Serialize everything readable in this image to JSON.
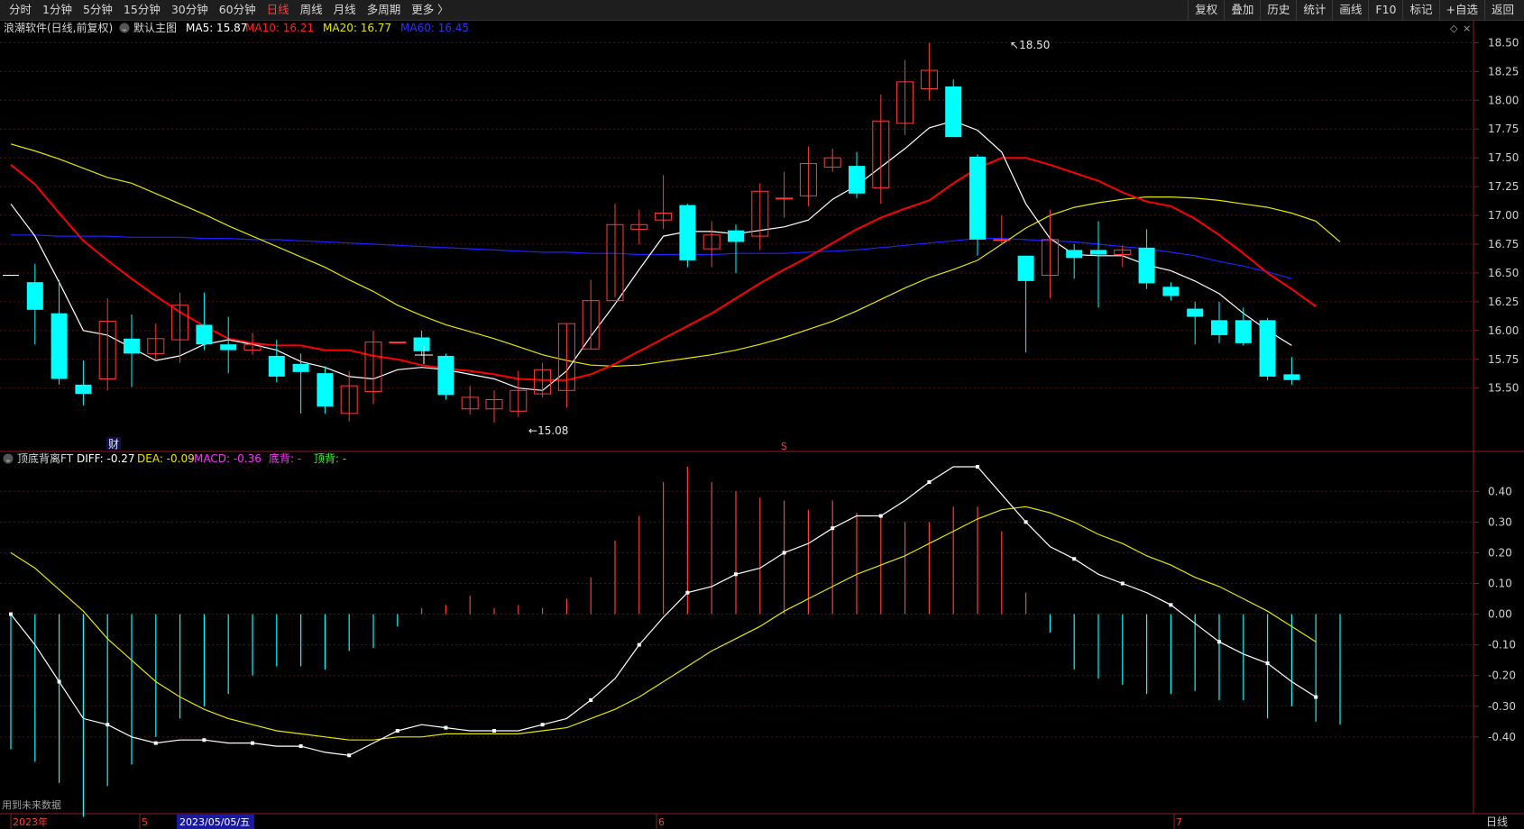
{
  "toolbar": {
    "left": [
      "分时",
      "1分钟",
      "5分钟",
      "15分钟",
      "30分钟",
      "60分钟",
      "日线",
      "周线",
      "月线",
      "多周期",
      "更多 〉"
    ],
    "active": "日线",
    "right": [
      "复权",
      "叠加",
      "历史",
      "统计",
      "画线",
      "F10",
      "标记",
      "+自选",
      "返回"
    ]
  },
  "main_panel": {
    "title": "浪潮软件(日线,前复权)",
    "style_label": "默认主图",
    "ma5": "MA5: 15.87",
    "ma10": "MA10: 16.21",
    "ma20": "MA20: 16.77",
    "ma60": "MA60: 16.45",
    "high_label": "18.50",
    "low_label": "15.08",
    "cai_marker": "财",
    "s_marker": "S"
  },
  "macd_panel": {
    "title": "顶底背离FT",
    "diff": "DIFF: -0.27",
    "dea": "DEA: -0.09",
    "macd": "MACD: -0.36",
    "bottom_div": "底背: -",
    "top_div": "顶背: -",
    "future_note": "用到未来数据"
  },
  "date_axis": {
    "labels": [
      "2023年",
      "5",
      "2023/05/05/五",
      "6",
      "7"
    ],
    "period_label": "日线"
  },
  "colors": {
    "up": "#ff3b3b",
    "down": "#00ffff",
    "ma5": "#ffffff",
    "ma10": "#ff0000",
    "ma20": "#e6e600",
    "ma60": "#2020ff",
    "macd_pos": "#ff3b3b",
    "macd_neg": "#00ffff"
  },
  "chart_data": [
    {
      "type": "candlestick",
      "price_axis": {
        "ticks": [
          18.5,
          18.25,
          18.0,
          17.75,
          17.5,
          17.25,
          17.0,
          16.75,
          16.5,
          16.25,
          16.0,
          15.75,
          15.5
        ],
        "ylim": [
          14.95,
          18.55
        ]
      },
      "candles": [
        [
          16.48,
          16.48,
          16.48,
          16.48
        ],
        [
          16.42,
          16.18,
          16.58,
          15.88
        ],
        [
          16.15,
          15.58,
          16.44,
          15.53
        ],
        [
          15.53,
          15.45,
          15.74,
          15.35
        ],
        [
          15.58,
          16.08,
          16.28,
          15.48
        ],
        [
          15.93,
          15.8,
          16.14,
          15.51
        ],
        [
          15.8,
          15.93,
          16.06,
          15.75
        ],
        [
          15.92,
          16.22,
          16.33,
          15.72
        ],
        [
          16.05,
          15.88,
          16.33,
          15.83
        ],
        [
          15.88,
          15.83,
          16.12,
          15.63
        ],
        [
          15.83,
          15.88,
          15.98,
          15.79
        ],
        [
          15.78,
          15.6,
          15.92,
          15.55
        ],
        [
          15.71,
          15.64,
          15.8,
          15.28
        ],
        [
          15.63,
          15.34,
          15.69,
          15.28
        ],
        [
          15.28,
          15.52,
          15.65,
          15.21
        ],
        [
          15.47,
          15.9,
          16.0,
          15.36
        ],
        [
          15.9,
          15.9,
          15.9,
          15.9
        ],
        [
          15.94,
          15.82,
          16.0,
          15.78
        ],
        [
          15.78,
          15.44,
          15.8,
          15.4
        ],
        [
          15.32,
          15.42,
          15.52,
          15.27
        ],
        [
          15.32,
          15.4,
          15.48,
          15.2
        ],
        [
          15.3,
          15.48,
          15.65,
          15.25
        ],
        [
          15.45,
          15.66,
          15.72,
          15.42
        ],
        [
          15.48,
          16.06,
          16.06,
          15.33
        ],
        [
          15.84,
          16.26,
          16.44,
          15.84
        ],
        [
          16.26,
          16.92,
          17.1,
          16.29
        ],
        [
          16.88,
          16.92,
          17.05,
          16.75
        ],
        [
          16.96,
          17.02,
          17.35,
          16.88
        ],
        [
          17.09,
          16.61,
          17.1,
          16.55
        ],
        [
          16.71,
          16.83,
          16.95,
          16.55
        ],
        [
          16.87,
          16.77,
          16.92,
          16.5
        ],
        [
          16.82,
          17.21,
          17.28,
          16.7
        ],
        [
          17.15,
          17.15,
          17.38,
          16.98
        ],
        [
          17.17,
          17.45,
          17.6,
          17.08
        ],
        [
          17.42,
          17.5,
          17.58,
          17.38
        ],
        [
          17.43,
          17.19,
          17.55,
          17.15
        ],
        [
          17.24,
          17.82,
          18.05,
          17.1
        ],
        [
          17.8,
          18.16,
          18.35,
          17.7
        ],
        [
          18.1,
          18.26,
          18.5,
          18.0
        ],
        [
          18.12,
          17.68,
          18.18,
          17.68
        ],
        [
          17.51,
          16.79,
          17.53,
          16.65
        ],
        [
          16.79,
          16.79,
          17.0,
          16.75
        ],
        [
          16.65,
          16.43,
          16.65,
          15.81
        ],
        [
          16.48,
          16.79,
          17.05,
          16.28
        ],
        [
          16.7,
          16.63,
          16.75,
          16.45
        ],
        [
          16.7,
          16.66,
          16.95,
          16.2
        ],
        [
          16.66,
          16.7,
          16.74,
          16.55
        ],
        [
          16.72,
          16.41,
          16.88,
          16.36
        ],
        [
          16.38,
          16.3,
          16.42,
          16.26
        ],
        [
          16.19,
          16.12,
          16.25,
          15.88
        ],
        [
          16.09,
          15.96,
          16.25,
          15.89
        ],
        [
          16.09,
          15.89,
          16.2,
          15.87
        ],
        [
          16.09,
          15.6,
          16.11,
          15.57
        ],
        [
          15.62,
          15.57,
          15.77,
          15.53
        ]
      ],
      "ma5": [
        17.1,
        16.82,
        16.42,
        16.0,
        15.96,
        15.85,
        15.74,
        15.78,
        15.88,
        15.92,
        15.88,
        15.83,
        15.73,
        15.68,
        15.6,
        15.58,
        15.66,
        15.68,
        15.66,
        15.62,
        15.58,
        15.5,
        15.48,
        15.65,
        15.95,
        16.23,
        16.53,
        16.82,
        16.86,
        16.86,
        16.84,
        16.87,
        16.9,
        16.96,
        17.14,
        17.26,
        17.42,
        17.58,
        17.76,
        17.82,
        17.74,
        17.55,
        17.1,
        16.8,
        16.66,
        16.65,
        16.65,
        16.57,
        16.52,
        16.43,
        16.32,
        16.15,
        16.0,
        15.87
      ],
      "ma10": [
        17.44,
        17.27,
        17.02,
        16.78,
        16.61,
        16.45,
        16.3,
        16.16,
        16.04,
        15.93,
        15.89,
        15.87,
        15.87,
        15.83,
        15.83,
        15.78,
        15.75,
        15.7,
        15.67,
        15.65,
        15.62,
        15.58,
        15.57,
        15.57,
        15.62,
        15.71,
        15.82,
        15.93,
        16.04,
        16.15,
        16.28,
        16.41,
        16.53,
        16.64,
        16.76,
        16.88,
        16.98,
        17.06,
        17.13,
        17.28,
        17.41,
        17.5,
        17.5,
        17.44,
        17.37,
        17.3,
        17.2,
        17.12,
        17.08,
        16.97,
        16.83,
        16.67,
        16.5,
        16.36,
        16.21
      ],
      "ma20": [
        17.62,
        17.56,
        17.49,
        17.41,
        17.33,
        17.28,
        17.19,
        17.1,
        17.01,
        16.91,
        16.82,
        16.73,
        16.64,
        16.55,
        16.44,
        16.34,
        16.22,
        16.13,
        16.05,
        15.99,
        15.93,
        15.86,
        15.79,
        15.74,
        15.7,
        15.69,
        15.7,
        15.73,
        15.76,
        15.79,
        15.83,
        15.88,
        15.94,
        16.01,
        16.08,
        16.17,
        16.27,
        16.37,
        16.46,
        16.53,
        16.61,
        16.75,
        16.89,
        17.0,
        17.07,
        17.11,
        17.14,
        17.16,
        17.16,
        17.15,
        17.13,
        17.1,
        17.07,
        17.02,
        16.95,
        16.77
      ],
      "ma60": [
        16.83,
        16.83,
        16.82,
        16.82,
        16.82,
        16.81,
        16.81,
        16.81,
        16.8,
        16.8,
        16.79,
        16.79,
        16.78,
        16.77,
        16.76,
        16.75,
        16.74,
        16.73,
        16.72,
        16.71,
        16.7,
        16.69,
        16.68,
        16.68,
        16.67,
        16.67,
        16.66,
        16.66,
        16.66,
        16.66,
        16.67,
        16.67,
        16.67,
        16.68,
        16.69,
        16.7,
        16.72,
        16.74,
        16.76,
        16.78,
        16.8,
        16.8,
        16.79,
        16.78,
        16.77,
        16.75,
        16.73,
        16.71,
        16.68,
        16.65,
        16.6,
        16.56,
        16.51,
        16.45
      ]
    },
    {
      "type": "macd",
      "axis_ticks": [
        0.4,
        0.3,
        0.2,
        0.1,
        0.0,
        -0.1,
        -0.2,
        -0.3,
        -0.4
      ],
      "ylim": [
        -0.65,
        0.53
      ],
      "diff": [
        0.0,
        -0.1,
        -0.22,
        -0.34,
        -0.36,
        -0.4,
        -0.42,
        -0.41,
        -0.41,
        -0.42,
        -0.42,
        -0.43,
        -0.43,
        -0.45,
        -0.46,
        -0.42,
        -0.38,
        -0.36,
        -0.37,
        -0.38,
        -0.38,
        -0.38,
        -0.36,
        -0.34,
        -0.28,
        -0.21,
        -0.1,
        -0.01,
        0.07,
        0.09,
        0.13,
        0.15,
        0.2,
        0.23,
        0.28,
        0.32,
        0.32,
        0.37,
        0.43,
        0.48,
        0.48,
        0.39,
        0.3,
        0.22,
        0.18,
        0.13,
        0.1,
        0.07,
        0.03,
        -0.03,
        -0.09,
        -0.13,
        -0.16,
        -0.22,
        -0.27
      ],
      "dea": [
        0.2,
        0.15,
        0.08,
        0.01,
        -0.08,
        -0.15,
        -0.22,
        -0.27,
        -0.31,
        -0.34,
        -0.36,
        -0.38,
        -0.39,
        -0.4,
        -0.41,
        -0.41,
        -0.4,
        -0.4,
        -0.39,
        -0.39,
        -0.39,
        -0.39,
        -0.38,
        -0.37,
        -0.34,
        -0.31,
        -0.27,
        -0.22,
        -0.17,
        -0.12,
        -0.08,
        -0.04,
        0.01,
        0.05,
        0.09,
        0.13,
        0.16,
        0.19,
        0.23,
        0.27,
        0.31,
        0.34,
        0.35,
        0.33,
        0.3,
        0.26,
        0.23,
        0.19,
        0.16,
        0.12,
        0.09,
        0.05,
        0.01,
        -0.04,
        -0.09
      ],
      "macd": [
        -0.44,
        -0.48,
        -0.55,
        -0.66,
        -0.56,
        -0.49,
        -0.4,
        -0.34,
        -0.3,
        -0.26,
        -0.2,
        -0.17,
        -0.17,
        -0.18,
        -0.12,
        -0.11,
        -0.04,
        0.02,
        0.03,
        0.06,
        0.02,
        0.03,
        0.02,
        0.05,
        0.12,
        0.24,
        0.32,
        0.43,
        0.48,
        0.43,
        0.4,
        0.38,
        0.37,
        0.34,
        0.37,
        0.33,
        0.32,
        0.3,
        0.3,
        0.35,
        0.35,
        0.27,
        0.07,
        -0.06,
        -0.18,
        -0.21,
        -0.23,
        -0.26,
        -0.26,
        -0.25,
        -0.28,
        -0.28,
        -0.34,
        -0.3,
        -0.35,
        -0.36
      ]
    }
  ]
}
